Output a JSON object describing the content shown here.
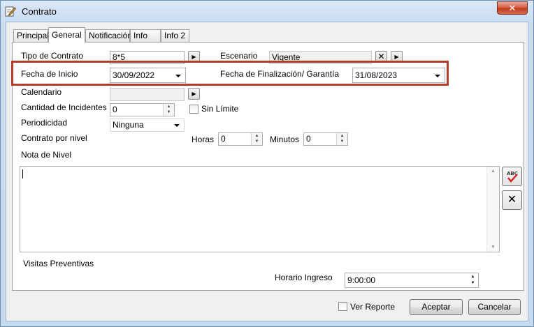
{
  "window": {
    "title": "Contrato"
  },
  "tabs": [
    {
      "label": "Principal"
    },
    {
      "label": "General",
      "active": true
    },
    {
      "label": "Notificación"
    },
    {
      "label": "Info"
    },
    {
      "label": "Info 2"
    }
  ],
  "general": {
    "tipo_contrato": {
      "label": "Tipo de Contrato",
      "value": "8*5"
    },
    "escenario": {
      "label": "Escenario",
      "value": "Vigente"
    },
    "fecha_inicio": {
      "label": "Fecha de Inicio",
      "value": "30/09/2022"
    },
    "fecha_fin": {
      "label": "Fecha de Finalización/ Garantía",
      "value": "31/08/2023"
    },
    "calendario": {
      "label": "Calendario",
      "value": ""
    },
    "cantidad_incidentes": {
      "label": "Cantidad de Incidentes",
      "value": "0"
    },
    "sin_limite": {
      "label": "Sin Límite",
      "checked": false
    },
    "periodicidad": {
      "label": "Periodicidad",
      "value": "Ninguna"
    },
    "contrato_por_nivel": {
      "label": "Contrato por nivel"
    },
    "horas": {
      "label": "Horas",
      "value": "0"
    },
    "minutos": {
      "label": "Minutos",
      "value": "0"
    },
    "nota_nivel": {
      "label": "Nota de Nivel",
      "value": ""
    }
  },
  "visitas": {
    "label": "Visitas Preventivas",
    "horario_label": "Horario Ingreso",
    "horario_value": "9:00:00"
  },
  "footer": {
    "ver_reporte_label": "Ver Reporte",
    "ver_reporte_checked": false,
    "accept_label": "Aceptar",
    "cancel_label": "Cancelar"
  },
  "colors": {
    "highlight": "#b43c2b",
    "close_button": "#c94a2e"
  }
}
